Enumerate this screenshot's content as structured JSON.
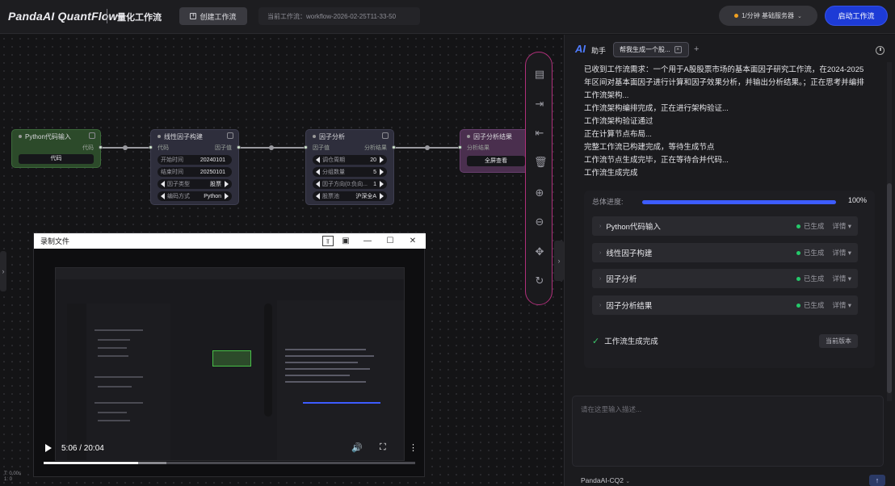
{
  "header": {
    "brand": "PandaAI QuantFlow",
    "subtitle": "量化工作流",
    "create_button": "创建工作流",
    "workflow_name": "当前工作流：workflow-2026-02-25T11-33-50",
    "server_label": "1/分钟  基础服务器",
    "launch_button": "启动工作流"
  },
  "nodes": {
    "python_input": {
      "title": "Python代码输入",
      "out_port": "代码",
      "button": "代码"
    },
    "factor_build": {
      "title": "线性因子构建",
      "in_port": "代码",
      "out_port": "因子值",
      "fields": [
        {
          "label": "开始时间",
          "value": "20240101"
        },
        {
          "label": "结束时间",
          "value": "20250101"
        },
        {
          "label": "因子类型",
          "value": "股票"
        },
        {
          "label": "编码方式",
          "value": "Python"
        }
      ]
    },
    "factor_analysis": {
      "title": "因子分析",
      "in_port": "因子值",
      "out_port": "分析结果",
      "fields": [
        {
          "label": "调仓周期",
          "value": "20"
        },
        {
          "label": "分组数量",
          "value": "5"
        },
        {
          "label": "因子方向(0:负向...",
          "value": "1"
        },
        {
          "label": "股票池",
          "value": "沪深全A"
        }
      ]
    },
    "factor_result": {
      "title": "因子分析结果",
      "in_port": "分析结果",
      "button": "全屏查看"
    }
  },
  "video": {
    "title": "录制文件",
    "time": "5:06 / 20:04",
    "progress": 0.255,
    "buffered": 0.33
  },
  "coords": {
    "line1": "T: 0.00s",
    "line2": "1: 0"
  },
  "panel": {
    "logo": "AI",
    "assistant": "助手",
    "tab_label": "帮我生成一个股...",
    "log": [
      "已收到工作流需求：一个用于A股股票市场的基本面因子研究工作流，在2024-2025年区间对基本面因子进行计算和因子效果分析，并输出分析结果。；正在思考并编排工作流架构...",
      "工作流架构编排完成，正在进行架构验证...",
      "工作流架构验证通过",
      "正在计算节点布局...",
      "完整工作流已构建完成，等待生成节点",
      "工作流节点生成完毕，正在等待合并代码...",
      "工作流生成完成"
    ],
    "progress_label": "总体进度:",
    "progress_value": 1.0,
    "progress_text": "100%",
    "steps": [
      {
        "name": "Python代码输入",
        "status": "已生成",
        "detail": "详情"
      },
      {
        "name": "线性因子构建",
        "status": "已生成",
        "detail": "详情"
      },
      {
        "name": "因子分析",
        "status": "已生成",
        "detail": "详情"
      },
      {
        "name": "因子分析结果",
        "status": "已生成",
        "detail": "详情"
      }
    ],
    "done_text": "工作流生成完成",
    "version_button": "当前版本",
    "input_placeholder": "请在这里输入描述...",
    "model": "PandaAI-CQ2"
  },
  "colors": {
    "accent": "#1d3bd6",
    "success": "#24c96a",
    "toolbar_border": "#b0307a"
  }
}
